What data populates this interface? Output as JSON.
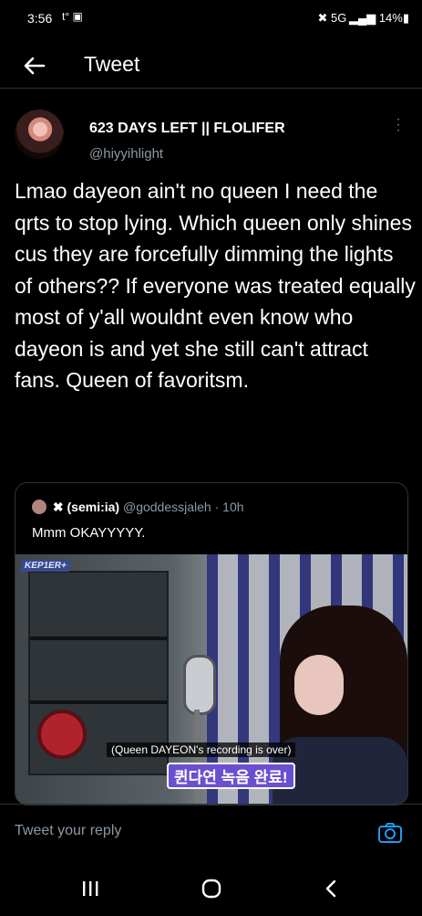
{
  "status_bar": {
    "time": "3:56",
    "left_icons": "t° ▣",
    "right": "✖ 5G ▂▄▆ 14%▮"
  },
  "app_bar": {
    "title": "Tweet",
    "back_icon": "arrow-left-icon"
  },
  "tweet": {
    "display_name": "623 DAYS LEFT || FLOLIFER",
    "handle": "@hiyyihlight",
    "text": "Lmao dayeon ain't no queen I need the qrts to stop lying. Which queen only shines cus they are forcefully dimming the lights of others?? If everyone was treated equally most of y'all wouldnt even know who dayeon is and yet she still can't attract fans. Queen of favoritsm."
  },
  "quoted_tweet": {
    "display_name": "✖ (semi:ia)",
    "handle": "@goddessjaleh",
    "time": "· 10h",
    "text": "Mmm OKAYYYYY.",
    "media": {
      "badge": "KEP1ER+",
      "caption_en": "(Queen DAYEON's recording is over)",
      "caption_ko": "퀸다연 녹음 완료!"
    }
  },
  "reply": {
    "placeholder": "Tweet your reply",
    "camera_icon": "camera-icon"
  },
  "nav_bar": {
    "recents_icon": "recents-icon",
    "home_icon": "home-icon",
    "back_icon": "back-icon"
  },
  "colors": {
    "background": "#000000",
    "text": "#e7e9ea",
    "secondary": "#8b98a5",
    "accent": "#1d9bf0"
  }
}
